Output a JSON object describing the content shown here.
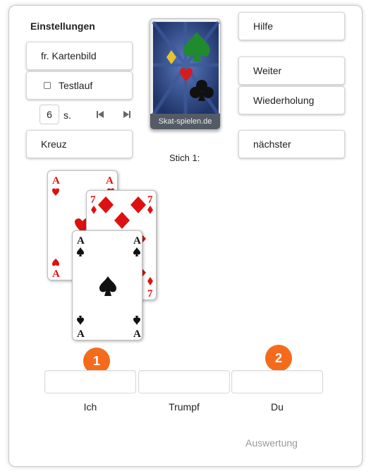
{
  "settings": {
    "heading": "Einstellungen",
    "card_image_button": "fr. Kartenbild",
    "test_run_label": "Testlauf",
    "test_run_checked": false,
    "seconds_value": "6",
    "seconds_unit": "s.",
    "suit_button": "Kreuz"
  },
  "deck": {
    "label": "Skat-spielen.de"
  },
  "right_buttons": {
    "help": "Hilfe",
    "next": "Weiter",
    "repeat": "Wiederholung",
    "following": "nächster"
  },
  "trick": {
    "label": "Stich 1:",
    "cards": [
      {
        "rank": "A",
        "suit": "hearts"
      },
      {
        "rank": "7",
        "suit": "diamonds"
      },
      {
        "rank": "A",
        "suit": "spades"
      }
    ]
  },
  "players": {
    "badges": [
      "1",
      "2"
    ],
    "slots": [
      "Ich",
      "Trumpf",
      "Du"
    ]
  },
  "evaluation_link": "Auswertung",
  "colors": {
    "badge": "#f56b1c",
    "red_suit": "#d11",
    "black_suit": "#111"
  },
  "icons": [
    "skip-back-icon",
    "skip-forward-icon",
    "checkbox-icon"
  ]
}
